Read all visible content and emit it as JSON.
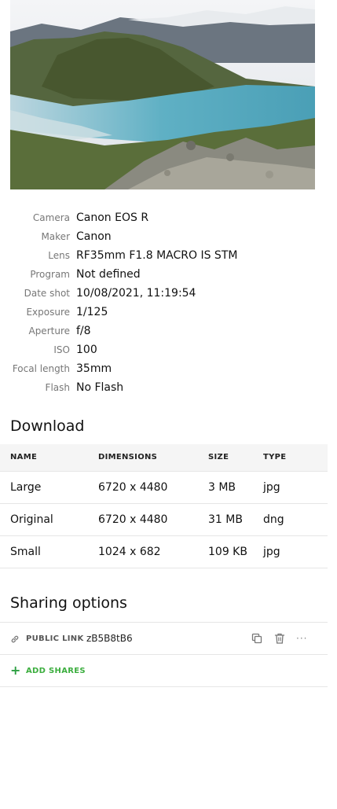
{
  "photo": {
    "alt_icon": "landscape-photo"
  },
  "exif": [
    {
      "key": "Camera",
      "value": "Canon EOS R"
    },
    {
      "key": "Maker",
      "value": "Canon"
    },
    {
      "key": "Lens",
      "value": "RF35mm F1.8 MACRO IS STM"
    },
    {
      "key": "Program",
      "value": "Not defined"
    },
    {
      "key": "Date shot",
      "value": "10/08/2021, 11:19:54"
    },
    {
      "key": "Exposure",
      "value": "1/125"
    },
    {
      "key": "Aperture",
      "value": "f/8"
    },
    {
      "key": "ISO",
      "value": "100"
    },
    {
      "key": "Focal length",
      "value": "35mm"
    },
    {
      "key": "Flash",
      "value": "No Flash"
    }
  ],
  "download": {
    "title": "Download",
    "headers": [
      "NAME",
      "DIMENSIONS",
      "SIZE",
      "TYPE"
    ],
    "rows": [
      [
        "Large",
        "6720 x 4480",
        "3 MB",
        "jpg"
      ],
      [
        "Original",
        "6720 x 4480",
        "31 MB",
        "dng"
      ],
      [
        "Small",
        "1024 x 682",
        "109 KB",
        "jpg"
      ]
    ]
  },
  "sharing": {
    "title": "Sharing options",
    "public_label": "PUBLIC LINK",
    "code": "zB5B8tB6",
    "more": "···",
    "add_label": "ADD SHARES",
    "accent": "#3cae3f"
  }
}
